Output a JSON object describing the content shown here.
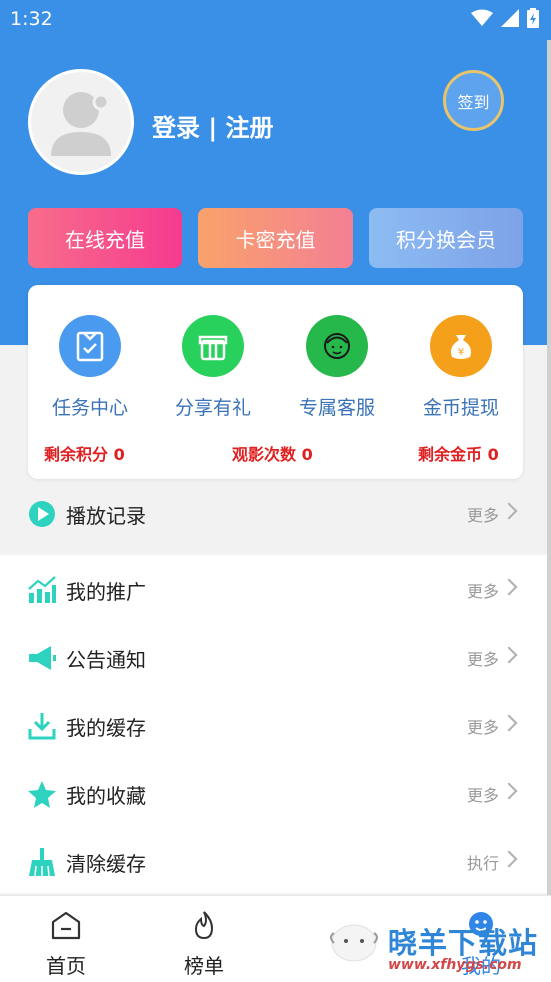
{
  "status_bar": {
    "time": "1:32"
  },
  "profile": {
    "login_text": "登录 | 注册",
    "signin_label": "签到"
  },
  "actions": [
    {
      "label": "在线充值"
    },
    {
      "label": "卡密充值"
    },
    {
      "label": "积分换会员"
    }
  ],
  "features": [
    {
      "label": "任务中心",
      "icon": "task-icon",
      "color": "#4a9af0"
    },
    {
      "label": "分享有礼",
      "icon": "gift-icon",
      "color": "#28d05c"
    },
    {
      "label": "专属客服",
      "icon": "service-icon",
      "color": "#26b84a"
    },
    {
      "label": "金币提现",
      "icon": "money-bag-icon",
      "color": "#f5a01a"
    }
  ],
  "stats": {
    "points": "剩余积分 0",
    "views": "观影次数 0",
    "coins": "剩余金币 0"
  },
  "menu": [
    {
      "label": "播放记录",
      "action": "更多",
      "icon": "play-icon"
    },
    {
      "label": "我的推广",
      "action": "更多",
      "icon": "chart-icon"
    },
    {
      "label": "公告通知",
      "action": "更多",
      "icon": "megaphone-icon"
    },
    {
      "label": "我的缓存",
      "action": "更多",
      "icon": "download-icon"
    },
    {
      "label": "我的收藏",
      "action": "更多",
      "icon": "star-icon"
    },
    {
      "label": "清除缓存",
      "action": "执行",
      "icon": "broom-icon"
    }
  ],
  "tabbar": [
    {
      "label": "首页",
      "icon": "home-icon"
    },
    {
      "label": "榜单",
      "icon": "flame-icon"
    },
    {
      "label": "我的",
      "icon": "user-face-icon"
    }
  ],
  "watermark": {
    "text": "晓羊下载站",
    "url": "www.xfhygs.com"
  },
  "colors": {
    "header": "#3a8fe6",
    "accent_teal": "#2ed3c0"
  }
}
